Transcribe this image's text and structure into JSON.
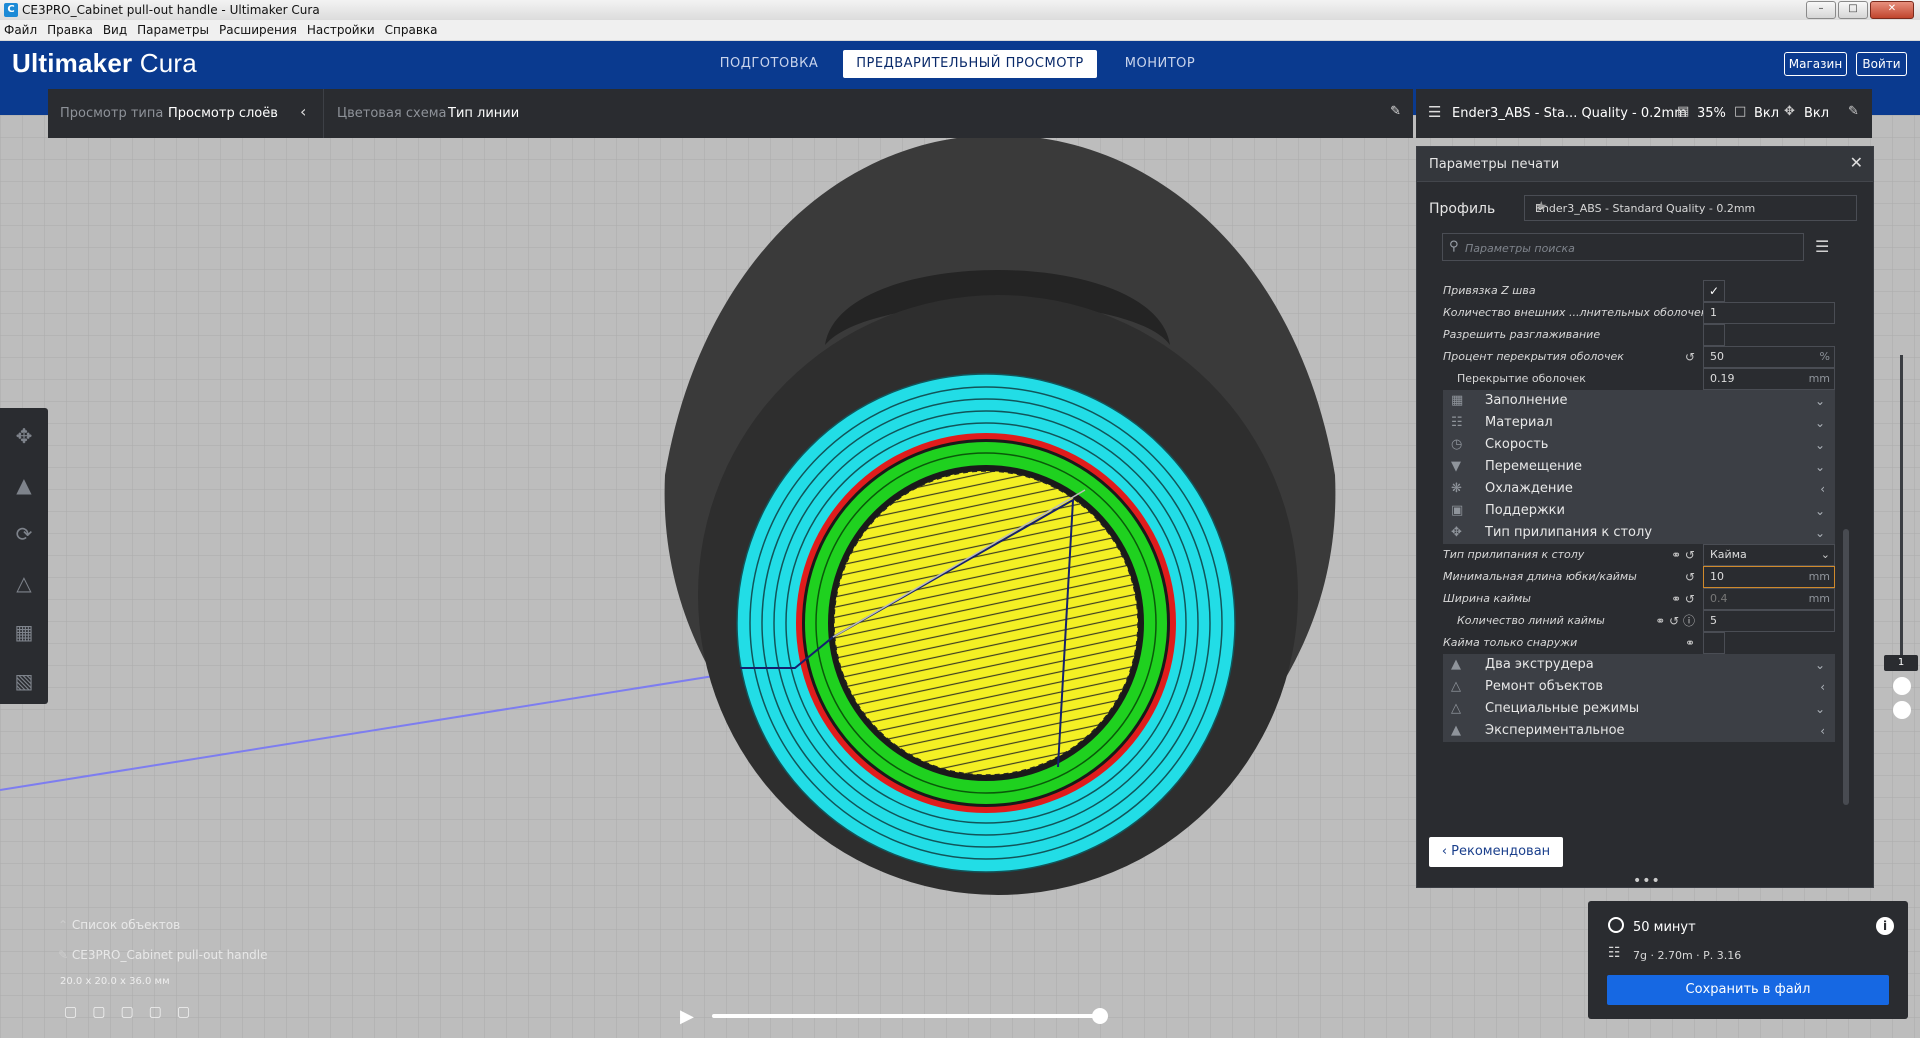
{
  "window": {
    "title": "CE3PRO_Cabinet pull-out handle - Ultimaker Cura",
    "app_icon": "C"
  },
  "menu": [
    "Файл",
    "Правка",
    "Вид",
    "Параметры",
    "Расширения",
    "Настройки",
    "Справка"
  ],
  "header": {
    "logo_brand": "Ultimaker",
    "logo_product": "Cura",
    "stages": [
      {
        "label": "ПОДГОТОВКА"
      },
      {
        "label": "ПРЕДВАРИТЕЛЬНЫЙ ПРОСМОТР"
      },
      {
        "label": "МОНИТОР"
      }
    ],
    "marketplace_label": "Магазин",
    "signin_label": "Войти"
  },
  "viewbar": {
    "view_type_label": "Просмотр типа",
    "view_type_value": "Просмотр слоёв",
    "color_scheme_label": "Цветовая схема",
    "color_scheme_value": "Тип линии"
  },
  "settingsbar": {
    "profile_short": "Ender3_ABS - Sta... Quality - 0.2mm",
    "infill": "35%",
    "support": "Вкл",
    "adhesion": "Вкл"
  },
  "panel": {
    "title": "Параметры печати",
    "profile_label": "Профиль",
    "profile_value": "Ender3_ABS - Standard Quality - 0.2mm",
    "search_placeholder": "Параметры поиска",
    "settings_top": [
      {
        "label": "Привязка Z шва",
        "type": "check",
        "checked": true
      },
      {
        "label": "Количество внешних ...лнительных оболочек",
        "type": "value",
        "value": "1",
        "unit": ""
      },
      {
        "label": "Разрешить разглаживание",
        "type": "check",
        "checked": false
      },
      {
        "label": "Процент перекрытия оболочек",
        "type": "value",
        "value": "50",
        "unit": "%"
      },
      {
        "label": "Перекрытие оболочек",
        "type": "value",
        "value": "0.19",
        "unit": "mm"
      }
    ],
    "categories_mid": [
      {
        "label": "Заполнение",
        "icon": "infill-icon"
      },
      {
        "label": "Материал",
        "icon": "material-icon"
      },
      {
        "label": "Скорость",
        "icon": "speed-icon"
      },
      {
        "label": "Перемещение",
        "icon": "travel-icon"
      },
      {
        "label": "Охлаждение",
        "icon": "cooling-icon"
      },
      {
        "label": "Поддержки",
        "icon": "support-icon"
      },
      {
        "label": "Тип прилипания к столу",
        "icon": "adhesion-icon"
      }
    ],
    "adhesion_settings": [
      {
        "label": "Тип прилипания к столу",
        "value": "Кайма",
        "unit": "",
        "kind": "select"
      },
      {
        "label": "Минимальная длина юбки/каймы",
        "value": "10",
        "unit": "mm",
        "kind": "focus"
      },
      {
        "label": "Ширина каймы",
        "value": "0.4",
        "unit": "mm",
        "kind": "disabled"
      },
      {
        "label": "Количество линий каймы",
        "value": "5",
        "unit": "",
        "kind": "value"
      },
      {
        "label": "Кайма только снаружи",
        "value": "",
        "unit": "",
        "kind": "check"
      }
    ],
    "categories_bottom": [
      {
        "label": "Два экструдера",
        "icon": "dual-extrusion-icon"
      },
      {
        "label": "Ремонт объектов",
        "icon": "mesh-fixes-icon"
      },
      {
        "label": "Специальные режимы",
        "icon": "special-modes-icon"
      },
      {
        "label": "Экспериментальное",
        "icon": "experimental-icon"
      }
    ],
    "recommended_button": "Рекомендован"
  },
  "layer_slider": {
    "current_layer": "1"
  },
  "output": {
    "print_time": "50 минут",
    "material_estimate": "7g · 2.70m · Р. 3.16",
    "save_button": "Сохранить в файл"
  },
  "object_list": {
    "header": "Список объектов",
    "object_name": "CE3PRO_Cabinet pull-out handle",
    "dimensions": "20.0 x 20.0 x 36.0 мм"
  },
  "colors": {
    "header_blue": "#0a3a8f",
    "panel_dark": "#2a2c30",
    "accent_blue": "#1668e3",
    "skirt_cyan": "#22dde6",
    "wall_red": "#e01c1c",
    "inner_wall_green": "#1fd11f",
    "top_bottom_yellow": "#f4f024"
  }
}
